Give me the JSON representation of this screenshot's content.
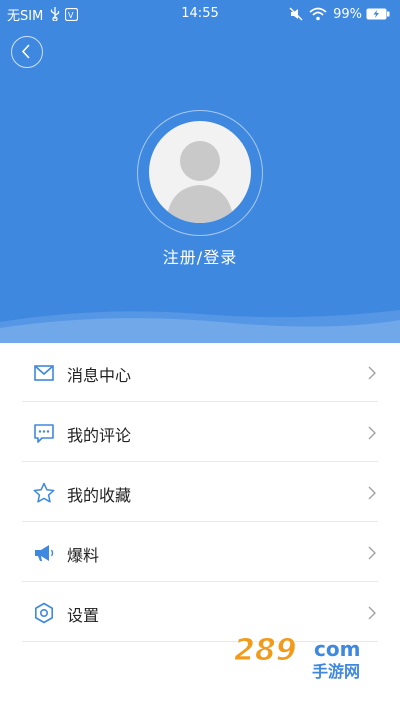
{
  "status_bar": {
    "carrier": "无SIM",
    "time": "14:55",
    "battery": "99%"
  },
  "header": {
    "login_label": "注册/登录",
    "background_color": "#3f88e0"
  },
  "menu": [
    {
      "label": "消息中心",
      "icon": "mail-icon"
    },
    {
      "label": "我的评论",
      "icon": "comment-icon"
    },
    {
      "label": "我的收藏",
      "icon": "star-icon"
    },
    {
      "label": "爆料",
      "icon": "megaphone-icon"
    },
    {
      "label": "设置",
      "icon": "gear-icon"
    }
  ],
  "watermark": {
    "number": "289",
    "suffix": "com",
    "subtitle": "手游网"
  },
  "colors": {
    "accent": "#3f88e0",
    "watermark_orange": "#f39a1b"
  }
}
